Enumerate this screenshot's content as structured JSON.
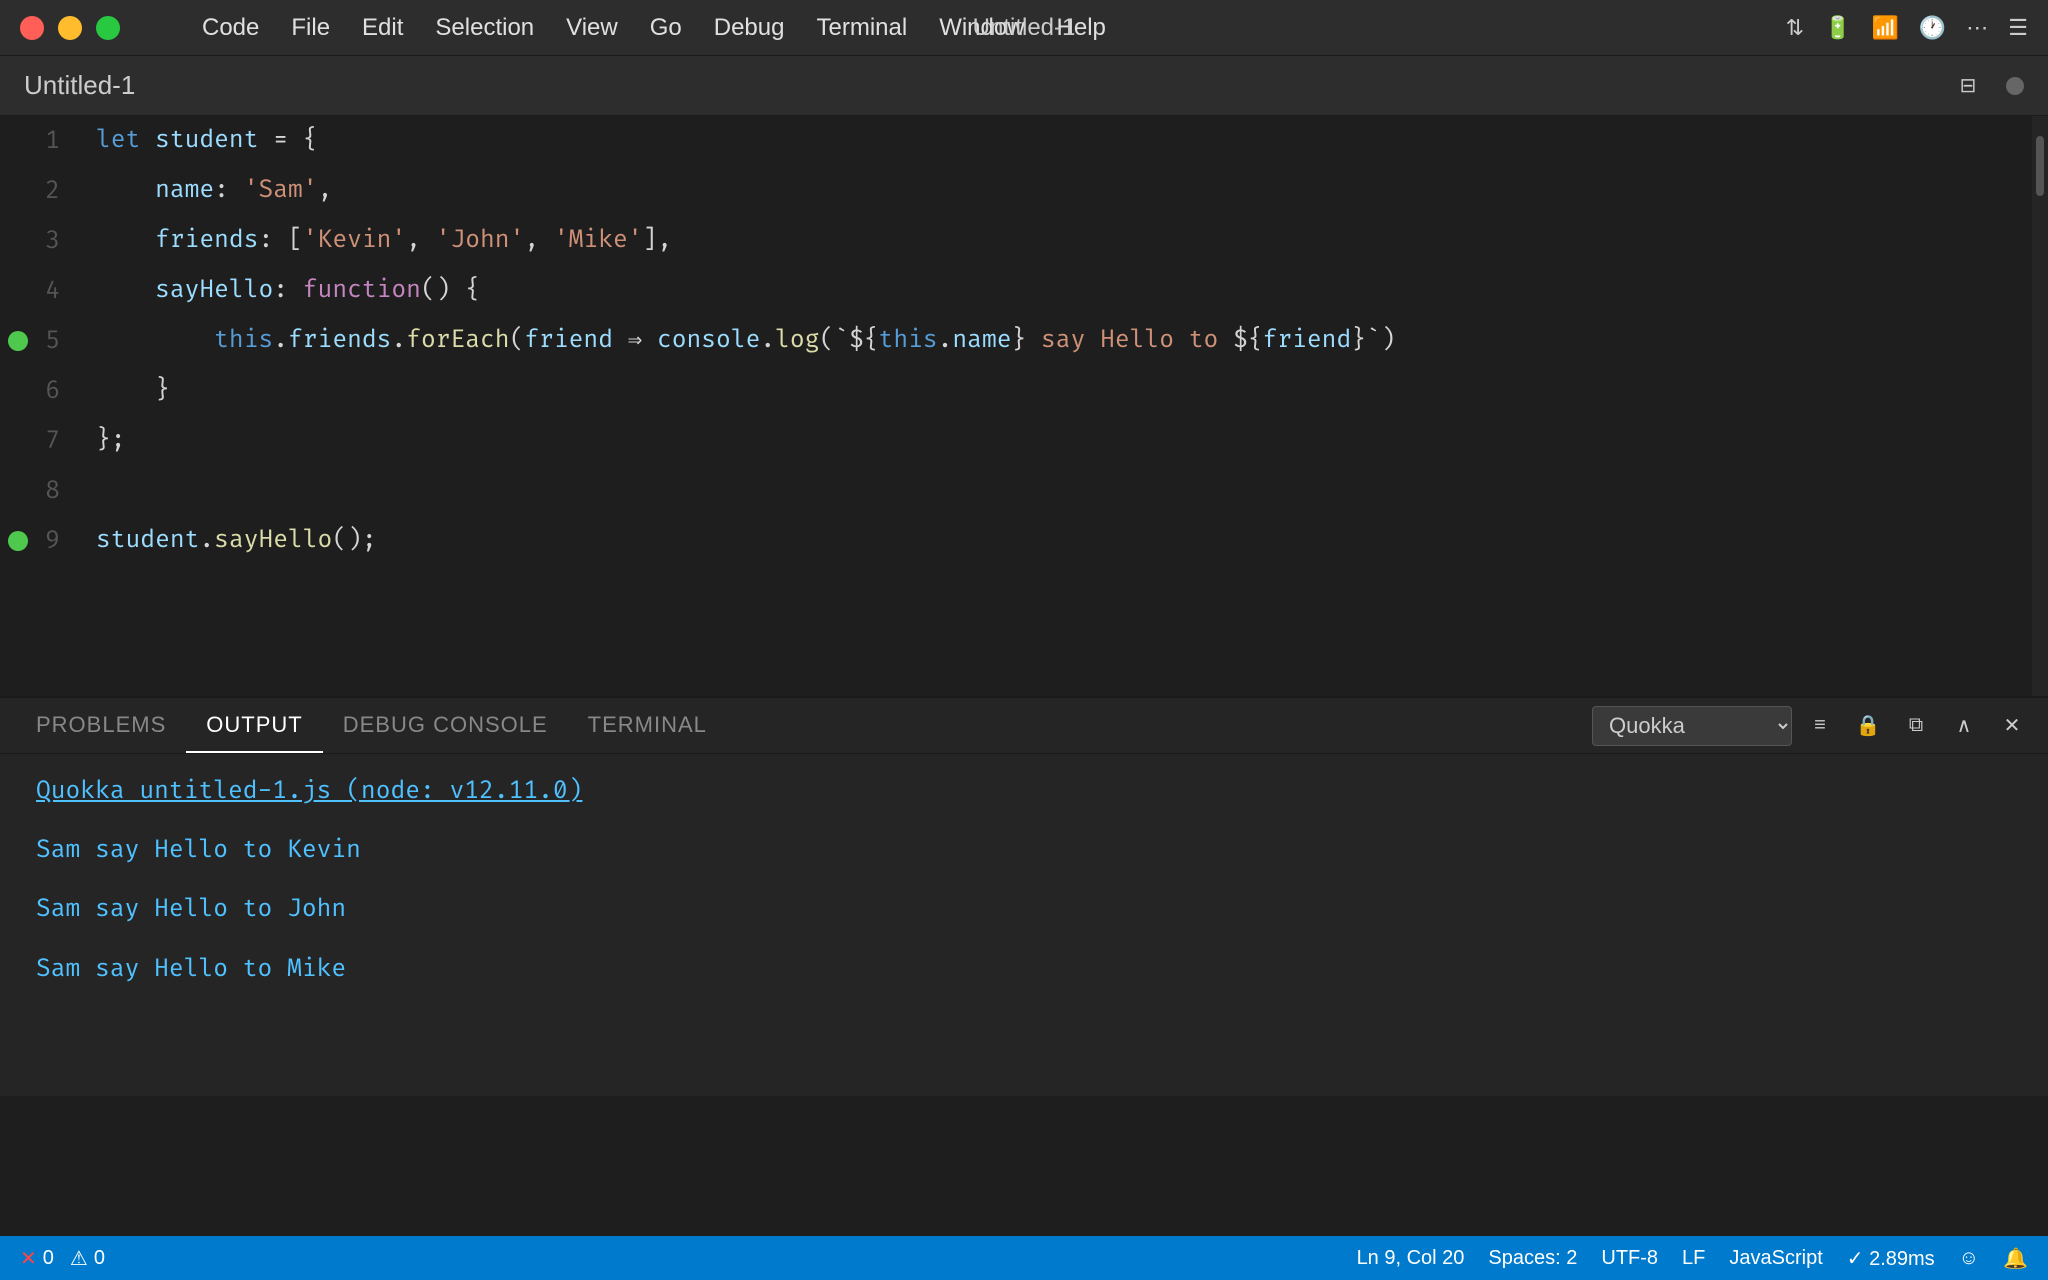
{
  "titlebar": {
    "title": "Untitled-1",
    "menu": [
      "",
      "Code",
      "File",
      "Edit",
      "Selection",
      "View",
      "Go",
      "Debug",
      "Terminal",
      "Window",
      "Help"
    ]
  },
  "tab": {
    "title": "Untitled-1"
  },
  "editor": {
    "lines": [
      {
        "num": 1,
        "breakpoint": false,
        "tokens": [
          {
            "text": "let ",
            "cls": "kw"
          },
          {
            "text": "student",
            "cls": "var-name"
          },
          {
            "text": " = {",
            "cls": "punct"
          }
        ]
      },
      {
        "num": 2,
        "breakpoint": false,
        "tokens": [
          {
            "text": "    name",
            "cls": "prop"
          },
          {
            "text": ": ",
            "cls": "punct"
          },
          {
            "text": "'Sam'",
            "cls": "str"
          },
          {
            "text": ",",
            "cls": "punct"
          }
        ]
      },
      {
        "num": 3,
        "breakpoint": false,
        "tokens": [
          {
            "text": "    friends",
            "cls": "prop"
          },
          {
            "text": ": [",
            "cls": "punct"
          },
          {
            "text": "'Kevin'",
            "cls": "str"
          },
          {
            "text": ", ",
            "cls": "punct"
          },
          {
            "text": "'John'",
            "cls": "str"
          },
          {
            "text": ", ",
            "cls": "punct"
          },
          {
            "text": "'Mike'",
            "cls": "str"
          },
          {
            "text": "],",
            "cls": "punct"
          }
        ]
      },
      {
        "num": 4,
        "breakpoint": false,
        "tokens": [
          {
            "text": "    sayHello",
            "cls": "prop"
          },
          {
            "text": ": ",
            "cls": "punct"
          },
          {
            "text": "function",
            "cls": "purple"
          },
          {
            "text": "() {",
            "cls": "punct"
          }
        ]
      },
      {
        "num": 5,
        "breakpoint": true,
        "tokens": [
          {
            "text": "        this",
            "cls": "this-kw"
          },
          {
            "text": ".",
            "cls": "punct"
          },
          {
            "text": "friends",
            "cls": "prop"
          },
          {
            "text": ".",
            "cls": "punct"
          },
          {
            "text": "forEach",
            "cls": "yellow"
          },
          {
            "text": "(",
            "cls": "punct"
          },
          {
            "text": "friend",
            "cls": "var-name"
          },
          {
            "text": " ⇒ ",
            "cls": "punct"
          },
          {
            "text": "console",
            "cls": "var-name"
          },
          {
            "text": ".",
            "cls": "punct"
          },
          {
            "text": "log",
            "cls": "yellow"
          },
          {
            "text": "(`${",
            "cls": "punct"
          },
          {
            "text": "this",
            "cls": "this-kw"
          },
          {
            "text": ".",
            "cls": "punct"
          },
          {
            "text": "name",
            "cls": "prop"
          },
          {
            "text": "}",
            "cls": "punct"
          },
          {
            "text": " say Hello to ",
            "cls": "str"
          },
          {
            "text": "${",
            "cls": "punct"
          },
          {
            "text": "friend",
            "cls": "var-name"
          },
          {
            "text": "}`)",
            "cls": "punct"
          }
        ]
      },
      {
        "num": 6,
        "breakpoint": false,
        "tokens": [
          {
            "text": "    }",
            "cls": "punct"
          }
        ]
      },
      {
        "num": 7,
        "breakpoint": false,
        "tokens": [
          {
            "text": "};",
            "cls": "punct"
          }
        ]
      },
      {
        "num": 8,
        "breakpoint": false,
        "tokens": []
      },
      {
        "num": 9,
        "breakpoint": true,
        "tokens": [
          {
            "text": "student",
            "cls": "var-name"
          },
          {
            "text": ".",
            "cls": "punct"
          },
          {
            "text": "sayHello",
            "cls": "yellow"
          },
          {
            "text": "();",
            "cls": "punct"
          }
        ]
      }
    ]
  },
  "panel": {
    "tabs": [
      "PROBLEMS",
      "OUTPUT",
      "DEBUG CONSOLE",
      "TERMINAL"
    ],
    "active_tab": "OUTPUT",
    "dropdown_value": "Quokka",
    "output_lines": [
      {
        "text": "Quokka  untitled-1.js  (node: v12.11.0)",
        "cls": "output-header"
      },
      {
        "text": "Sam say Hello to Kevin",
        "cls": "output-line"
      },
      {
        "text": "Sam say Hello to John",
        "cls": "output-line"
      },
      {
        "text": "Sam say Hello to Mike",
        "cls": "output-line"
      }
    ]
  },
  "statusbar": {
    "errors": "0",
    "warnings": "0",
    "position": "Ln 9, Col 20",
    "spaces": "Spaces: 2",
    "encoding": "UTF-8",
    "eol": "LF",
    "language": "JavaScript",
    "extension": "✓ 2.89ms",
    "smiley": "☺"
  }
}
